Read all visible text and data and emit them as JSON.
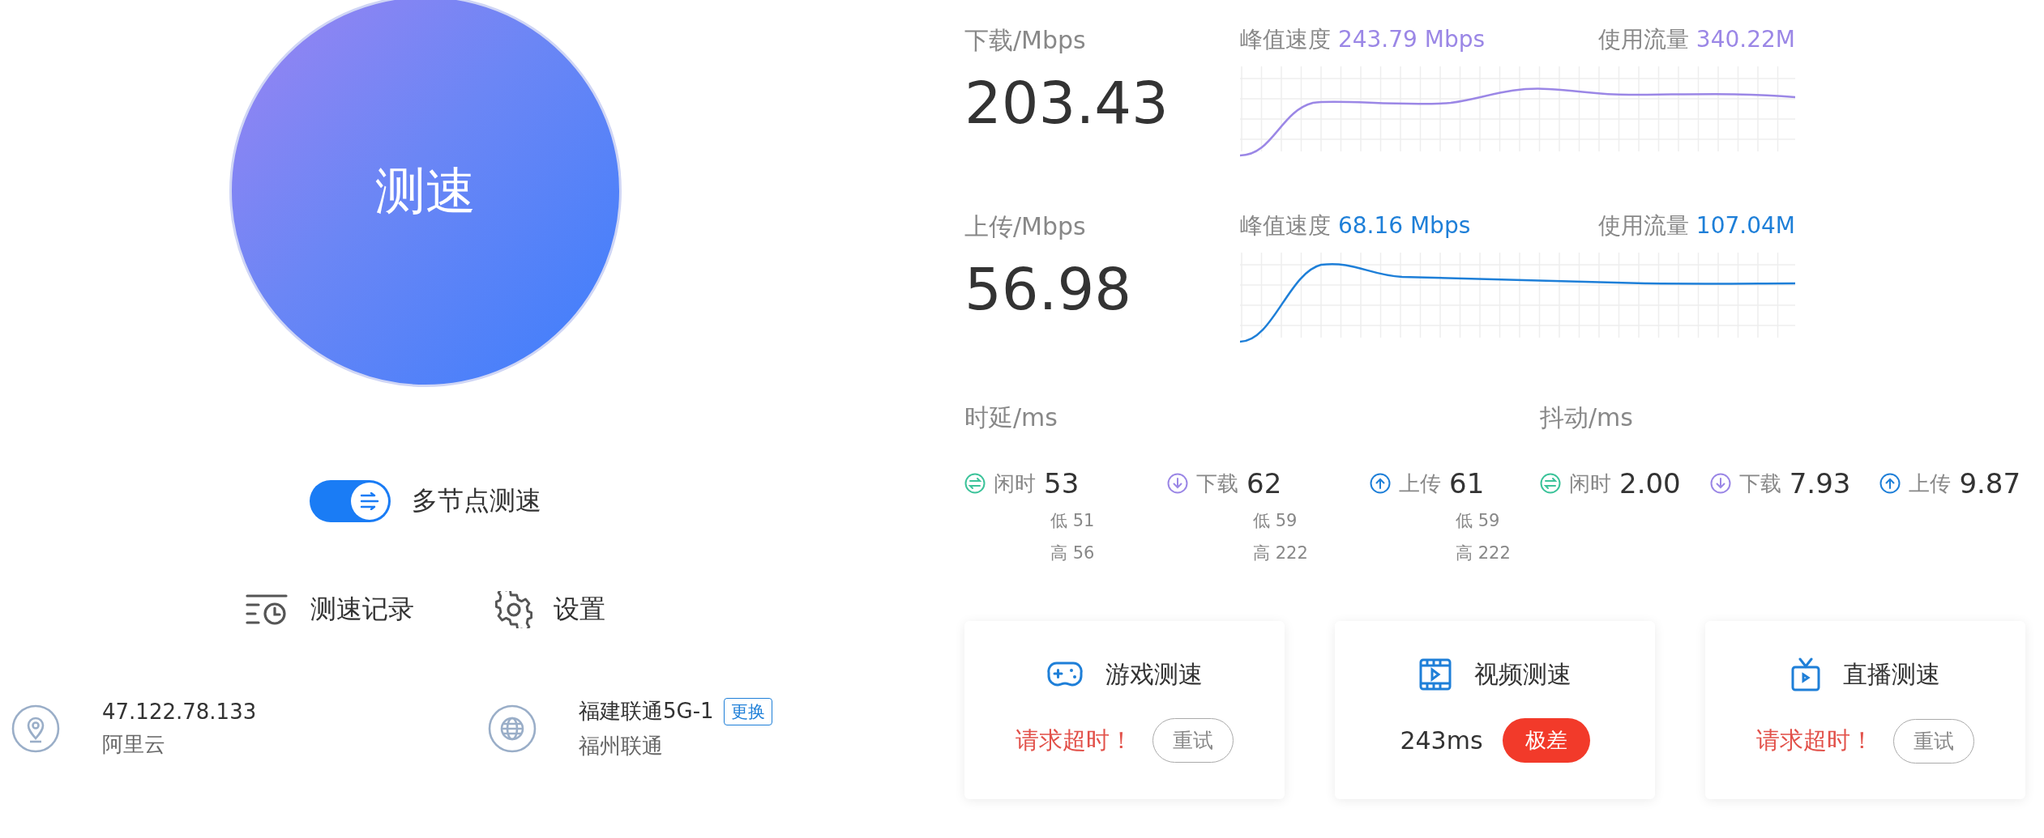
{
  "start_button": {
    "label": "测速"
  },
  "multi_node": {
    "label": "多节点测速",
    "on": true
  },
  "actions": [
    {
      "kind": "history",
      "label": "测速记录"
    },
    {
      "kind": "settings",
      "label": "设置"
    }
  ],
  "ip_info": {
    "ip": "47.122.78.133",
    "provider": "阿里云"
  },
  "server": {
    "name": "福建联通5G-1",
    "change": "更换",
    "location": "福州联通"
  },
  "speeds": [
    {
      "label": "下载/Mbps",
      "value": "203.43",
      "peak_label": "峰值速度",
      "peak": "243.79 Mbps",
      "usage_label": "使用流量",
      "usage": "340.22M",
      "color": "#9b87e6"
    },
    {
      "label": "上传/Mbps",
      "value": "56.98",
      "peak_label": "峰值速度",
      "peak": "68.16 Mbps",
      "usage_label": "使用流量",
      "usage": "107.04M",
      "color": "#1e7fd8"
    }
  ],
  "latency": {
    "title": "时延/ms",
    "items": [
      {
        "kind": "idle",
        "label": "闲时",
        "value": "53",
        "low": "低 51",
        "high": "高 56"
      },
      {
        "kind": "download",
        "label": "下载",
        "value": "62",
        "low": "低 59",
        "high": "高 222"
      },
      {
        "kind": "upload",
        "label": "上传",
        "value": "61",
        "low": "低 59",
        "high": "高 222"
      }
    ]
  },
  "jitter": {
    "title": "抖动/ms",
    "items": [
      {
        "kind": "idle",
        "label": "闲时",
        "value": "2.00"
      },
      {
        "kind": "download",
        "label": "下载",
        "value": "7.93"
      },
      {
        "kind": "upload",
        "label": "上传",
        "value": "9.87"
      }
    ]
  },
  "cards": [
    {
      "kind": "game",
      "title": "游戏测速",
      "timed_out": true,
      "message": "请求超时！",
      "button": "重试"
    },
    {
      "kind": "video",
      "title": "视频测速",
      "timed_out": false,
      "result": "243ms",
      "badge": "极差"
    },
    {
      "kind": "live",
      "title": "直播测速",
      "timed_out": true,
      "message": "请求超时！",
      "button": "重试"
    }
  ]
}
